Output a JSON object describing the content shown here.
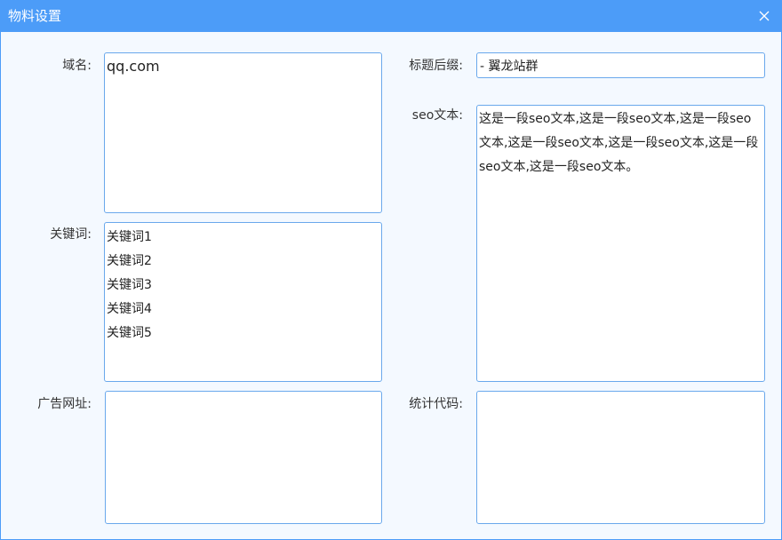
{
  "dialog": {
    "title": "物料设置"
  },
  "fields": {
    "domain": {
      "label": "域名:",
      "value": "qq.com"
    },
    "keywords": {
      "label": "关键词:",
      "value": "关键词1\n关键词2\n关键词3\n关键词4\n关键词5"
    },
    "ad_url": {
      "label": "广告网址:",
      "value": ""
    },
    "title_suffix": {
      "label": "标题后缀:",
      "value": "- 翼龙站群"
    },
    "seo_text": {
      "label": "seo文本:",
      "value": "这是一段seo文本,这是一段seo文本,这是一段seo文本,这是一段seo文本,这是一段seo文本,这是一段seo文本,这是一段seo文本。"
    },
    "stats_code": {
      "label": "统计代码:",
      "value": ""
    }
  },
  "icons": {
    "close": "close-icon"
  },
  "colors": {
    "titlebar": "#4c9cf8",
    "border": "#6aa8ec",
    "background": "#f4f9ff"
  }
}
